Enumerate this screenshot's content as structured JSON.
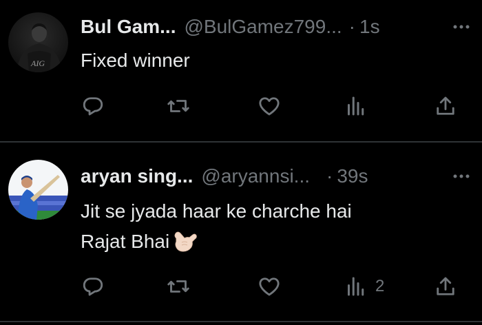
{
  "colors": {
    "background": "#000000",
    "text_primary": "#e7e9ea",
    "text_secondary": "#71767b",
    "divider": "#2f3336"
  },
  "tweets": [
    {
      "display_name": "Bul Gam...",
      "handle": "@BulGamez799...",
      "separator": "·",
      "time": "1s",
      "text_lines": [
        "Fixed winner"
      ],
      "emoji": "",
      "avatar_badge": "AIG",
      "stats": {
        "replies": "",
        "retweets": "",
        "likes": "",
        "views": ""
      },
      "icons": [
        "reply-icon",
        "retweet-icon",
        "like-icon",
        "views-icon",
        "share-icon",
        "more-icon"
      ]
    },
    {
      "display_name": "aryan sing...",
      "handle": "@aryannsi...",
      "separator": "·",
      "time": "39s",
      "text_lines": [
        "Jit se jyada haar ke charche hai",
        "Rajat Bhai"
      ],
      "emoji": "call-me-hand-emoji",
      "stats": {
        "replies": "",
        "retweets": "",
        "likes": "",
        "views": "2"
      },
      "icons": [
        "reply-icon",
        "retweet-icon",
        "like-icon",
        "views-icon",
        "share-icon",
        "more-icon"
      ]
    }
  ]
}
